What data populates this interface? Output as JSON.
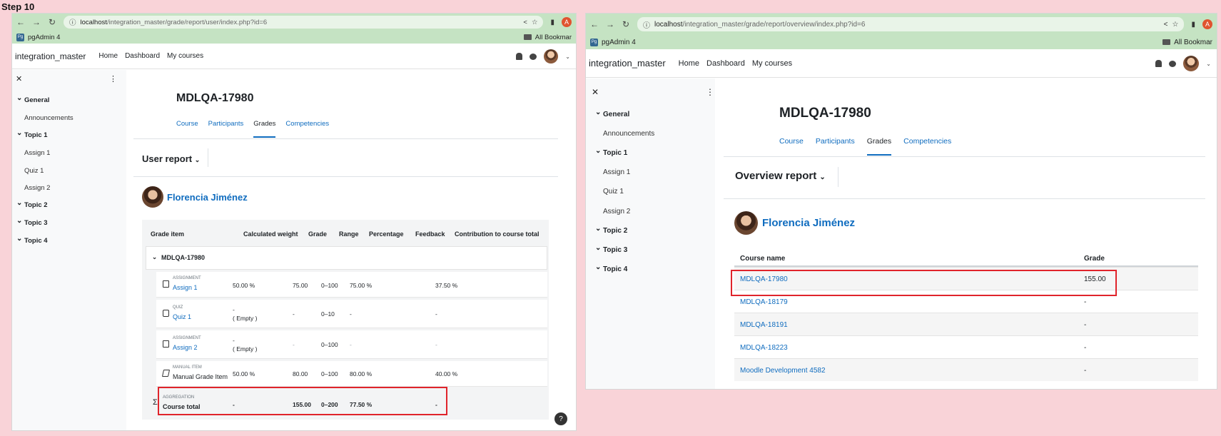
{
  "step_title": "Step 10",
  "left": {
    "url_host": "localhost",
    "url_path": "/integration_master/grade/report/user/index.php?id=6",
    "bookmark": "pgAdmin 4",
    "bookmark_icon": "Pg",
    "bookmarks_all": "All Bookmar",
    "profile_letter": "A",
    "site_name": "integration_master",
    "nav": [
      "Home",
      "Dashboard",
      "My courses"
    ],
    "sidebar": {
      "items": [
        {
          "label": "General",
          "kind": "section"
        },
        {
          "label": "Announcements",
          "kind": "activity"
        },
        {
          "label": "Topic 1",
          "kind": "section"
        },
        {
          "label": "Assign 1",
          "kind": "activity"
        },
        {
          "label": "Quiz 1",
          "kind": "activity"
        },
        {
          "label": "Assign 2",
          "kind": "activity"
        },
        {
          "label": "Topic 2",
          "kind": "section"
        },
        {
          "label": "Topic 3",
          "kind": "section"
        },
        {
          "label": "Topic 4",
          "kind": "section"
        }
      ]
    },
    "course_title": "MDLQA-17980",
    "tabs": [
      "Course",
      "Participants",
      "Grades",
      "Competencies"
    ],
    "active_tab": "Grades",
    "report_selector": "User report",
    "user_name": "Florencia Jiménez",
    "table": {
      "headers": [
        "Grade item",
        "Calculated weight",
        "Grade",
        "Range",
        "Percentage",
        "Feedback",
        "Contribution to course total"
      ],
      "category": "MDLQA-17980",
      "rows": [
        {
          "type": "ASSIGNMENT",
          "name": "Assign 1",
          "link": true,
          "weight": "50.00 %",
          "grade": "75.00",
          "range": "0–100",
          "percentage": "75.00 %",
          "feedback": "",
          "contribution": "37.50 %"
        },
        {
          "type": "QUIZ",
          "name": "Quiz 1",
          "link": true,
          "weight": "-",
          "weight_note": "( Empty )",
          "grade": "-",
          "range": "0–10",
          "percentage": "-",
          "feedback": "",
          "contribution": "-"
        },
        {
          "type": "ASSIGNMENT",
          "name": "Assign 2",
          "link": true,
          "weight": "-",
          "weight_note": "( Empty )",
          "grade": "-",
          "range": "0–100",
          "percentage": "-",
          "feedback": "",
          "contribution": "-"
        },
        {
          "type": "MANUAL ITEM",
          "name": "Manual Grade Item",
          "link": false,
          "weight": "50.00 %",
          "grade": "80.00",
          "range": "0–100",
          "percentage": "80.00 %",
          "feedback": "",
          "contribution": "40.00 %"
        }
      ],
      "total": {
        "type": "AGGREGATION",
        "name": "Course total",
        "weight": "-",
        "grade": "155.00",
        "range": "0–200",
        "percentage": "77.50 %",
        "contribution": "-"
      }
    },
    "help": "?"
  },
  "right": {
    "url_host": "localhost",
    "url_path": "/integration_master/grade/report/overview/index.php?id=6",
    "bookmark": "pgAdmin 4",
    "bookmark_icon": "Pg",
    "bookmarks_all": "All Bookmar",
    "profile_letter": "A",
    "site_name": "integration_master",
    "nav": [
      "Home",
      "Dashboard",
      "My courses"
    ],
    "sidebar": {
      "items": [
        {
          "label": "General",
          "kind": "section"
        },
        {
          "label": "Announcements",
          "kind": "activity"
        },
        {
          "label": "Topic 1",
          "kind": "section"
        },
        {
          "label": "Assign 1",
          "kind": "activity"
        },
        {
          "label": "Quiz 1",
          "kind": "activity"
        },
        {
          "label": "Assign 2",
          "kind": "activity"
        },
        {
          "label": "Topic 2",
          "kind": "section"
        },
        {
          "label": "Topic 3",
          "kind": "section"
        },
        {
          "label": "Topic 4",
          "kind": "section"
        }
      ]
    },
    "course_title": "MDLQA-17980",
    "tabs": [
      "Course",
      "Participants",
      "Grades",
      "Competencies"
    ],
    "active_tab": "Grades",
    "report_selector": "Overview report",
    "user_name": "Florencia Jiménez",
    "table": {
      "headers": [
        "Course name",
        "Grade"
      ],
      "rows": [
        {
          "course": "MDLQA-17980",
          "grade": "155.00"
        },
        {
          "course": "MDLQA-18179",
          "grade": "-"
        },
        {
          "course": "MDLQA-18191",
          "grade": "-"
        },
        {
          "course": "MDLQA-18223",
          "grade": "-"
        },
        {
          "course": "Moodle Development 4582",
          "grade": "-"
        }
      ]
    }
  },
  "colors": {
    "link": "#0f6cbf",
    "highlight": "#e0242b",
    "browser_bar": "#c5e3c3",
    "page_bg": "#f9d3d8"
  }
}
